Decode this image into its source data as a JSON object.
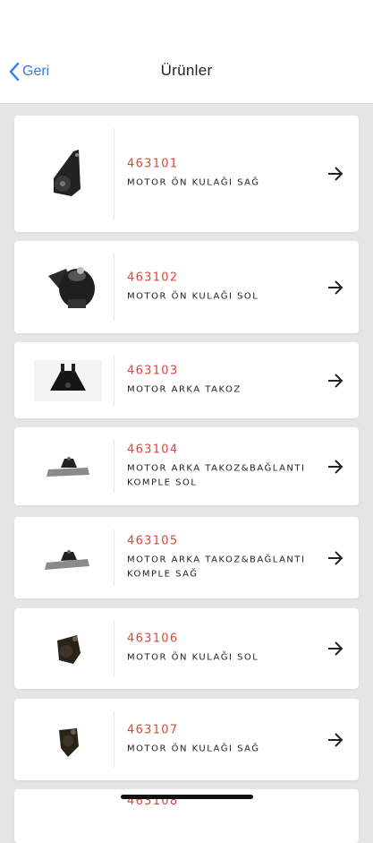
{
  "header": {
    "back_label": "Geri",
    "title": "Ürünler"
  },
  "colors": {
    "accent": "#2f7bf6",
    "code": "#d8493a",
    "background": "#e5e5e5"
  },
  "products": [
    {
      "code": "463101",
      "name": "MOTOR ÖN KULAĞI SAĞ",
      "icon": "engine-mount-bracket"
    },
    {
      "code": "463102",
      "name": "MOTOR ÖN KULAĞI SOL",
      "icon": "engine-mount-round"
    },
    {
      "code": "463103",
      "name": "MOTOR ARKA TAKOZ",
      "icon": "rear-mount-black"
    },
    {
      "code": "463104",
      "name": "MOTOR ARKA TAKOZ&BAĞLANTI KOMPLE SOL",
      "icon": "rear-mount-plate"
    },
    {
      "code": "463105",
      "name": "MOTOR ARKA TAKOZ&BAĞLANTI KOMPLE SAĞ",
      "icon": "rear-mount-plate"
    },
    {
      "code": "463106",
      "name": "MOTOR ÖN KULAĞI SOL",
      "icon": "engine-mount-small"
    },
    {
      "code": "463107",
      "name": "MOTOR ÖN KULAĞI SAĞ",
      "icon": "engine-mount-small"
    },
    {
      "code": "463108",
      "name": "",
      "icon": ""
    }
  ]
}
